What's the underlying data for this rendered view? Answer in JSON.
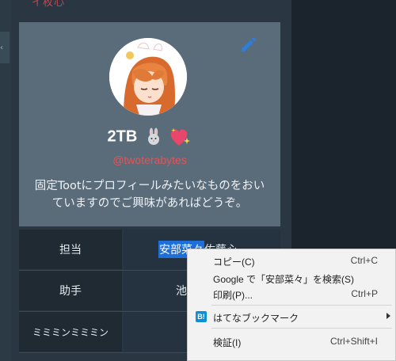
{
  "top_cut_text": "イ枚心",
  "profile": {
    "display_name": "2TB",
    "handle": "@twoterabytes",
    "bio_line1": "固定Tootにプロフィールみたいなものをおい",
    "bio_line2": "ていますのでご興味があればどうぞ。",
    "avatar_icon": "anime-girl-avatar",
    "edit_icon": "pencil-icon"
  },
  "fields": [
    {
      "key": "担当",
      "value_selected": "安部菜々",
      "value_rest": "佐藤心"
    },
    {
      "key": "助手",
      "value_selected": "",
      "value_rest": "池"
    },
    {
      "key": "ミミミンミミミン",
      "value_selected": "",
      "value_rest": ""
    }
  ],
  "context_menu": {
    "copy": {
      "label": "コピー(C)",
      "shortcut": "Ctrl+C"
    },
    "search": {
      "label": "Google で「安部菜々」を検索(S)"
    },
    "print": {
      "label": "印刷(P)...",
      "shortcut": "Ctrl+P"
    },
    "hatena": {
      "label": "はてなブックマーク",
      "icon_text": "B!"
    },
    "inspect": {
      "label": "検証(I)",
      "shortcut": "Ctrl+Shift+I"
    }
  },
  "colors": {
    "card_bg": "#5a6b7a",
    "handle": "#e0555a",
    "selection": "#1f6fd8",
    "hatena_blue": "#0a8fd8"
  }
}
